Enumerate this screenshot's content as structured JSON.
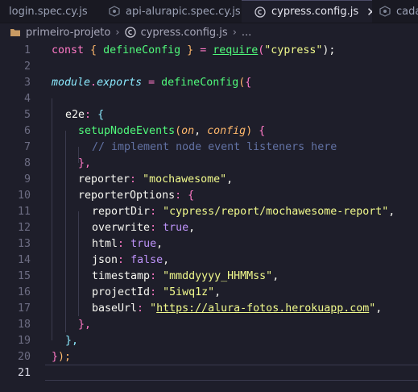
{
  "tabs": [
    {
      "label": "login.spec.cy.js",
      "icon": "js-file-icon",
      "active": false
    },
    {
      "label": "api-alurapic.spec.cy.js",
      "icon": "js-file-icon",
      "active": false
    },
    {
      "label": "cypress.config.js",
      "icon": "cypress-icon",
      "active": true,
      "close": "✕"
    },
    {
      "label": "cada",
      "icon": "js-file-icon",
      "active": false
    }
  ],
  "breadcrumb": {
    "folder": "primeiro-projeto",
    "file": "cypress.config.js",
    "more": "..."
  },
  "line_numbers": [
    "1",
    "2",
    "3",
    "4",
    "5",
    "6",
    "7",
    "8",
    "9",
    "10",
    "11",
    "12",
    "13",
    "14",
    "15",
    "16",
    "17",
    "18",
    "19",
    "20",
    "21"
  ],
  "code": {
    "l1_const": "const",
    "l1_open": "{",
    "l1_fn": "defineConfig",
    "l1_close": "}",
    "l1_eq": "=",
    "l1_require": "require",
    "l1_paren_open": "(",
    "l1_str": "\"cypress\"",
    "l1_end": ");",
    "l3_module": "module",
    "l3_dot": ".",
    "l3_exports": "exports",
    "l3_eq": "=",
    "l3_fn": "defineConfig",
    "l3_paren": "(",
    "l3_brace": "{",
    "l5_key": "e2e",
    "l5_colon": ":",
    "l5_brace": "{",
    "l6_fn": "setupNodeEvents",
    "l6_paren": "(",
    "l6_on": "on",
    "l6_comma": ",",
    "l6_config": "config",
    "l6_close": ")",
    "l6_brace": "{",
    "l7_comment": "// implement node event listeners here",
    "l8": "},",
    "l9_key": "reporter",
    "l9_colon": ":",
    "l9_str": "\"mochawesome\"",
    "l9_comma": ",",
    "l10_key": "reporterOptions",
    "l10_colon": ":",
    "l10_brace": "{",
    "l11_key": "reportDir",
    "l11_colon": ":",
    "l11_str": "\"cypress/report/mochawesome-report\"",
    "l11_comma": ",",
    "l12_key": "overwrite",
    "l12_colon": ":",
    "l12_val": "true",
    "l12_comma": ",",
    "l13_key": "html",
    "l13_colon": ":",
    "l13_val": "true",
    "l13_comma": ",",
    "l14_key": "json",
    "l14_colon": ":",
    "l14_val": "false",
    "l14_comma": ",",
    "l15_key": "timestamp",
    "l15_colon": ":",
    "l15_str": "\"mmddyyyy_HHMMss\"",
    "l15_comma": ",",
    "l16_key": "projectId",
    "l16_colon": ":",
    "l16_str": "\"5iwq1z\"",
    "l16_comma": ",",
    "l17_key": "baseUrl",
    "l17_colon": ":",
    "l17_q1": "\"",
    "l17_url": "https://alura-fotos.herokuapp.com",
    "l17_q2": "\"",
    "l17_comma": ",",
    "l18": "},",
    "l19": "},",
    "l20_brace": "}",
    "l20_end": ");"
  },
  "colors": {
    "background": "#1e1e2a",
    "keyword": "#ff79c6",
    "function": "#50fa7b",
    "string": "#f1fa8c",
    "boolean": "#bd93f9",
    "comment": "#6272a4"
  }
}
